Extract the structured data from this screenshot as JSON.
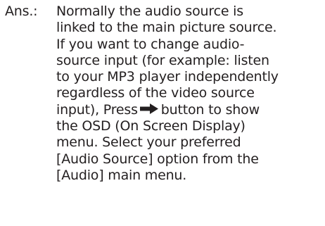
{
  "answer": {
    "label": "Ans.:",
    "lines": [
      "Normally the audio source is",
      "linked to the main picture source.",
      "If you want to change audio-",
      "source input (for example: listen",
      "to your MP3 player independently",
      "regardless of the video source"
    ],
    "line_before_icon": "input), Press",
    "icon": "right-arrow-icon",
    "line_after_icon": "button to show",
    "lines_after": [
      "the OSD (On Screen Display)",
      "menu. Select your preferred",
      "[Audio Source] option from the",
      "[Audio] main menu."
    ],
    "text_color": "#231f20"
  }
}
